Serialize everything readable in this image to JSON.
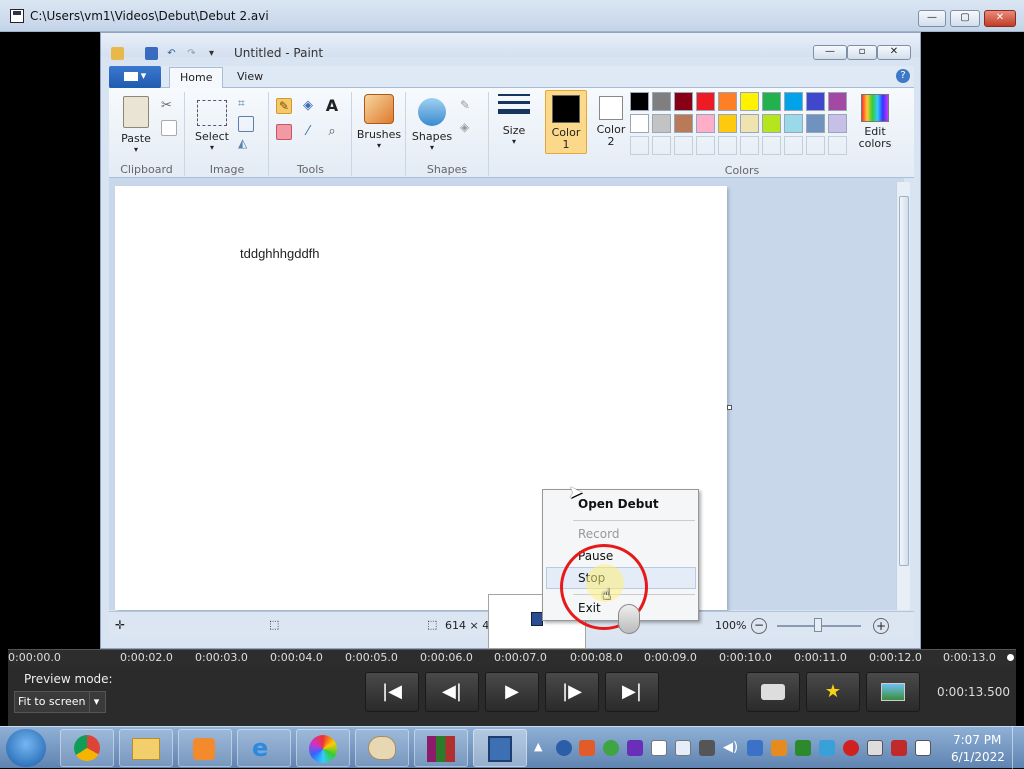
{
  "window": {
    "title": "C:\\Users\\vm1\\Videos\\Debut\\Debut 2.avi",
    "min": "—",
    "max": "▢",
    "close": "✕"
  },
  "paint": {
    "title": "Untitled - Paint",
    "tabs": [
      "Home",
      "View"
    ],
    "filemenu": "▾",
    "groups": {
      "clipboard": "Clipboard",
      "image": "Image",
      "tools": "Tools",
      "shapes": "Shapes",
      "colors": "Colors"
    },
    "buttons": {
      "paste": "Paste",
      "select": "Select",
      "brushes": "Brushes",
      "shapes": "Shapes",
      "size": "Size",
      "color1": "Color\n1",
      "color2": "Color\n2",
      "edit_colors": "Edit\ncolors"
    },
    "tool_a": "A",
    "palette_row1": [
      "#000000",
      "#7f7f7f",
      "#880015",
      "#ed1c24",
      "#ff7f27",
      "#fff200",
      "#22b14c",
      "#00a2e8",
      "#3f48cc",
      "#a349a4"
    ],
    "palette_row2": [
      "#ffffff",
      "#c3c3c3",
      "#b97a57",
      "#ffaec9",
      "#ffc90e",
      "#efe4b0",
      "#b5e61d",
      "#99d9ea",
      "#7092be",
      "#c8bfe7"
    ],
    "canvas_text": "tddghhhgddfh",
    "status": {
      "size": "614 × 46",
      "zoom": "100%"
    }
  },
  "context_menu": {
    "items": [
      "Open Debut",
      "Record",
      "Pause",
      "Stop",
      "Exit"
    ]
  },
  "timeline": {
    "labels": [
      "0:00:00.0",
      "0:00:02.0",
      "0:00:03.0",
      "0:00:04.0",
      "0:00:05.0",
      "0:00:06.0",
      "0:00:07.0",
      "0:00:08.0",
      "0:00:09.0",
      "0:00:10.0",
      "0:00:11.0",
      "0:00:12.0",
      "0:00:13.0"
    ]
  },
  "controls": {
    "preview_mode_label": "Preview mode:",
    "preview_mode_value": "Fit to screen",
    "time": "0:00:13.500",
    "btn_first": "|◀",
    "btn_prev": "◀|",
    "btn_play": "▶",
    "btn_next": "|▶",
    "btn_last": "▶|"
  },
  "taskbar": {
    "time": "7:07 PM",
    "date": "6/1/2022"
  }
}
